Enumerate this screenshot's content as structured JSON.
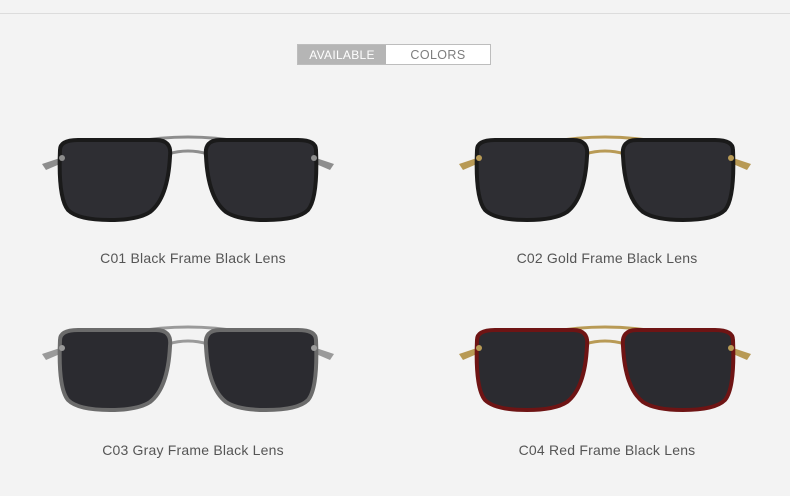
{
  "header": {
    "available_label": "AVAILABLE",
    "colors_label": "COLORS"
  },
  "products": [
    {
      "caption": "C01 Black Frame Black Lens",
      "frame_color": "#1a1a1a",
      "bridge_color": "#8d8d8d",
      "lens_color": "#2e2e33"
    },
    {
      "caption": "C02 Gold Frame Black Lens",
      "frame_color": "#1a1a1a",
      "bridge_color": "#b89a55",
      "lens_color": "#2e2e33"
    },
    {
      "caption": "C03 Gray Frame Black Lens",
      "frame_color": "#6b6b6b",
      "bridge_color": "#9a9a9a",
      "lens_color": "#2b2b30"
    },
    {
      "caption": "C04 Red Frame Black Lens",
      "frame_color": "#6e1414",
      "bridge_color": "#b89a55",
      "lens_color": "#2b2b30"
    }
  ]
}
